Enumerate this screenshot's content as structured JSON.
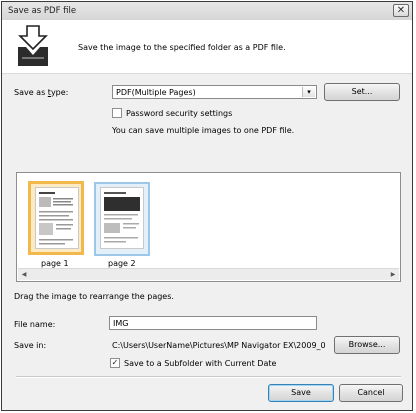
{
  "window": {
    "title": "Save as PDF file",
    "close_glyph": "✕"
  },
  "header": {
    "text": "Save the image to the specified folder as a PDF file.",
    "icon": "save-pdf-arrow-icon"
  },
  "save_as_type": {
    "label_pre": "Save as ",
    "label_u": "t",
    "label_post": "ype:",
    "value": "PDF(Multiple Pages)",
    "set_button": "Set..."
  },
  "password": {
    "label": "Password security settings",
    "checked": false
  },
  "info_text": "You can save multiple images to one PDF file.",
  "pages": [
    {
      "label": "page 1",
      "selected": true
    },
    {
      "label": "page 2",
      "selected": false
    }
  ],
  "drag_hint": "Drag the image to rearrange the pages.",
  "file_name": {
    "label": "File name:",
    "value": "IMG"
  },
  "save_in": {
    "label": "Save in:",
    "value": "C:\\Users\\UserName\\Pictures\\MP Navigator EX\\2009_0",
    "browse_button": "Browse..."
  },
  "subfolder": {
    "label": "Save to a Subfolder with Current Date",
    "checked": true
  },
  "buttons": {
    "save": "Save",
    "cancel": "Cancel"
  },
  "colors": {
    "accent": "#3c7fb1",
    "selection": "#f2b84b"
  }
}
